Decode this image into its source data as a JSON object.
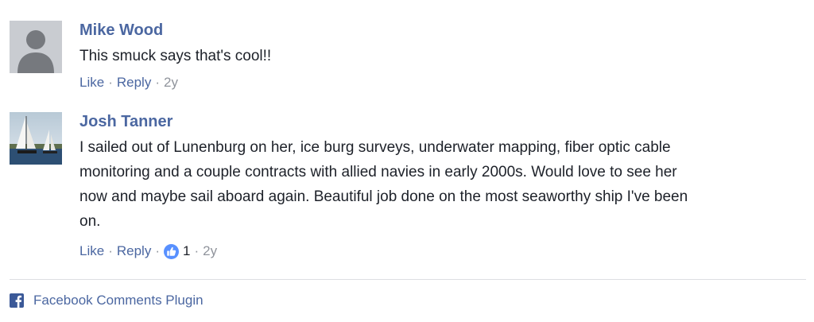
{
  "comments": [
    {
      "author": "Mike Wood",
      "avatar": "default-silhouette-avatar",
      "text": "This smuck says that's cool!!",
      "actions": {
        "like": "Like",
        "reply": "Reply",
        "sep": "·",
        "time": "2y"
      }
    },
    {
      "author": "Josh Tanner",
      "avatar": "sailboats-photo-avatar",
      "text_lines": [
        "I sailed out of Lunenburg on her, ice burg surveys, underwater mapping, fiber optic cable",
        "monitoring and a couple contracts with allied navies in early 2000s. Would love to see her",
        "now and maybe sail aboard again. Beautiful job done on the most seaworthy ship I've been",
        "on."
      ],
      "actions": {
        "like": "Like",
        "reply": "Reply",
        "sep": "·",
        "likes": "1",
        "time": "2y"
      }
    }
  ],
  "footer": {
    "label": "Facebook Comments Plugin",
    "icon": "facebook-icon"
  },
  "colors": {
    "link": "#4b67a1",
    "text": "#1d2129",
    "meta": "#90949c",
    "divider": "#dddfe2",
    "like_blue": "#5890ff",
    "facebook_blue": "#3b5998"
  }
}
